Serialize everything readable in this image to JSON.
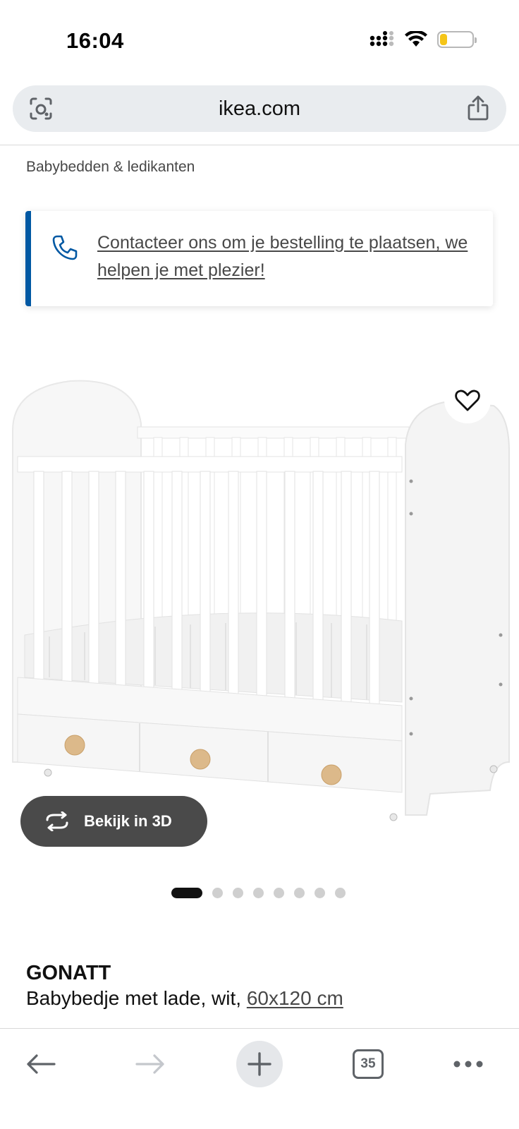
{
  "status_bar": {
    "time": "16:04"
  },
  "browser": {
    "url": "ikea.com",
    "open_tabs": "35"
  },
  "breadcrumb": "Babybedden & ledikanten",
  "contact_banner": {
    "text": "Contacteer ons om je bestelling te plaatsen, we helpen je met plezier!"
  },
  "product": {
    "view_3d_label": "Bekijk in 3D",
    "image_count": 8,
    "active_image": 1,
    "name": "GONATT",
    "description": "Babybedje met lade, wit, ",
    "size": "60x120 cm"
  },
  "colors": {
    "accent_blue": "#0058a3",
    "battery_level": "#f5c518",
    "pill_dark": "#4a4a4a"
  }
}
